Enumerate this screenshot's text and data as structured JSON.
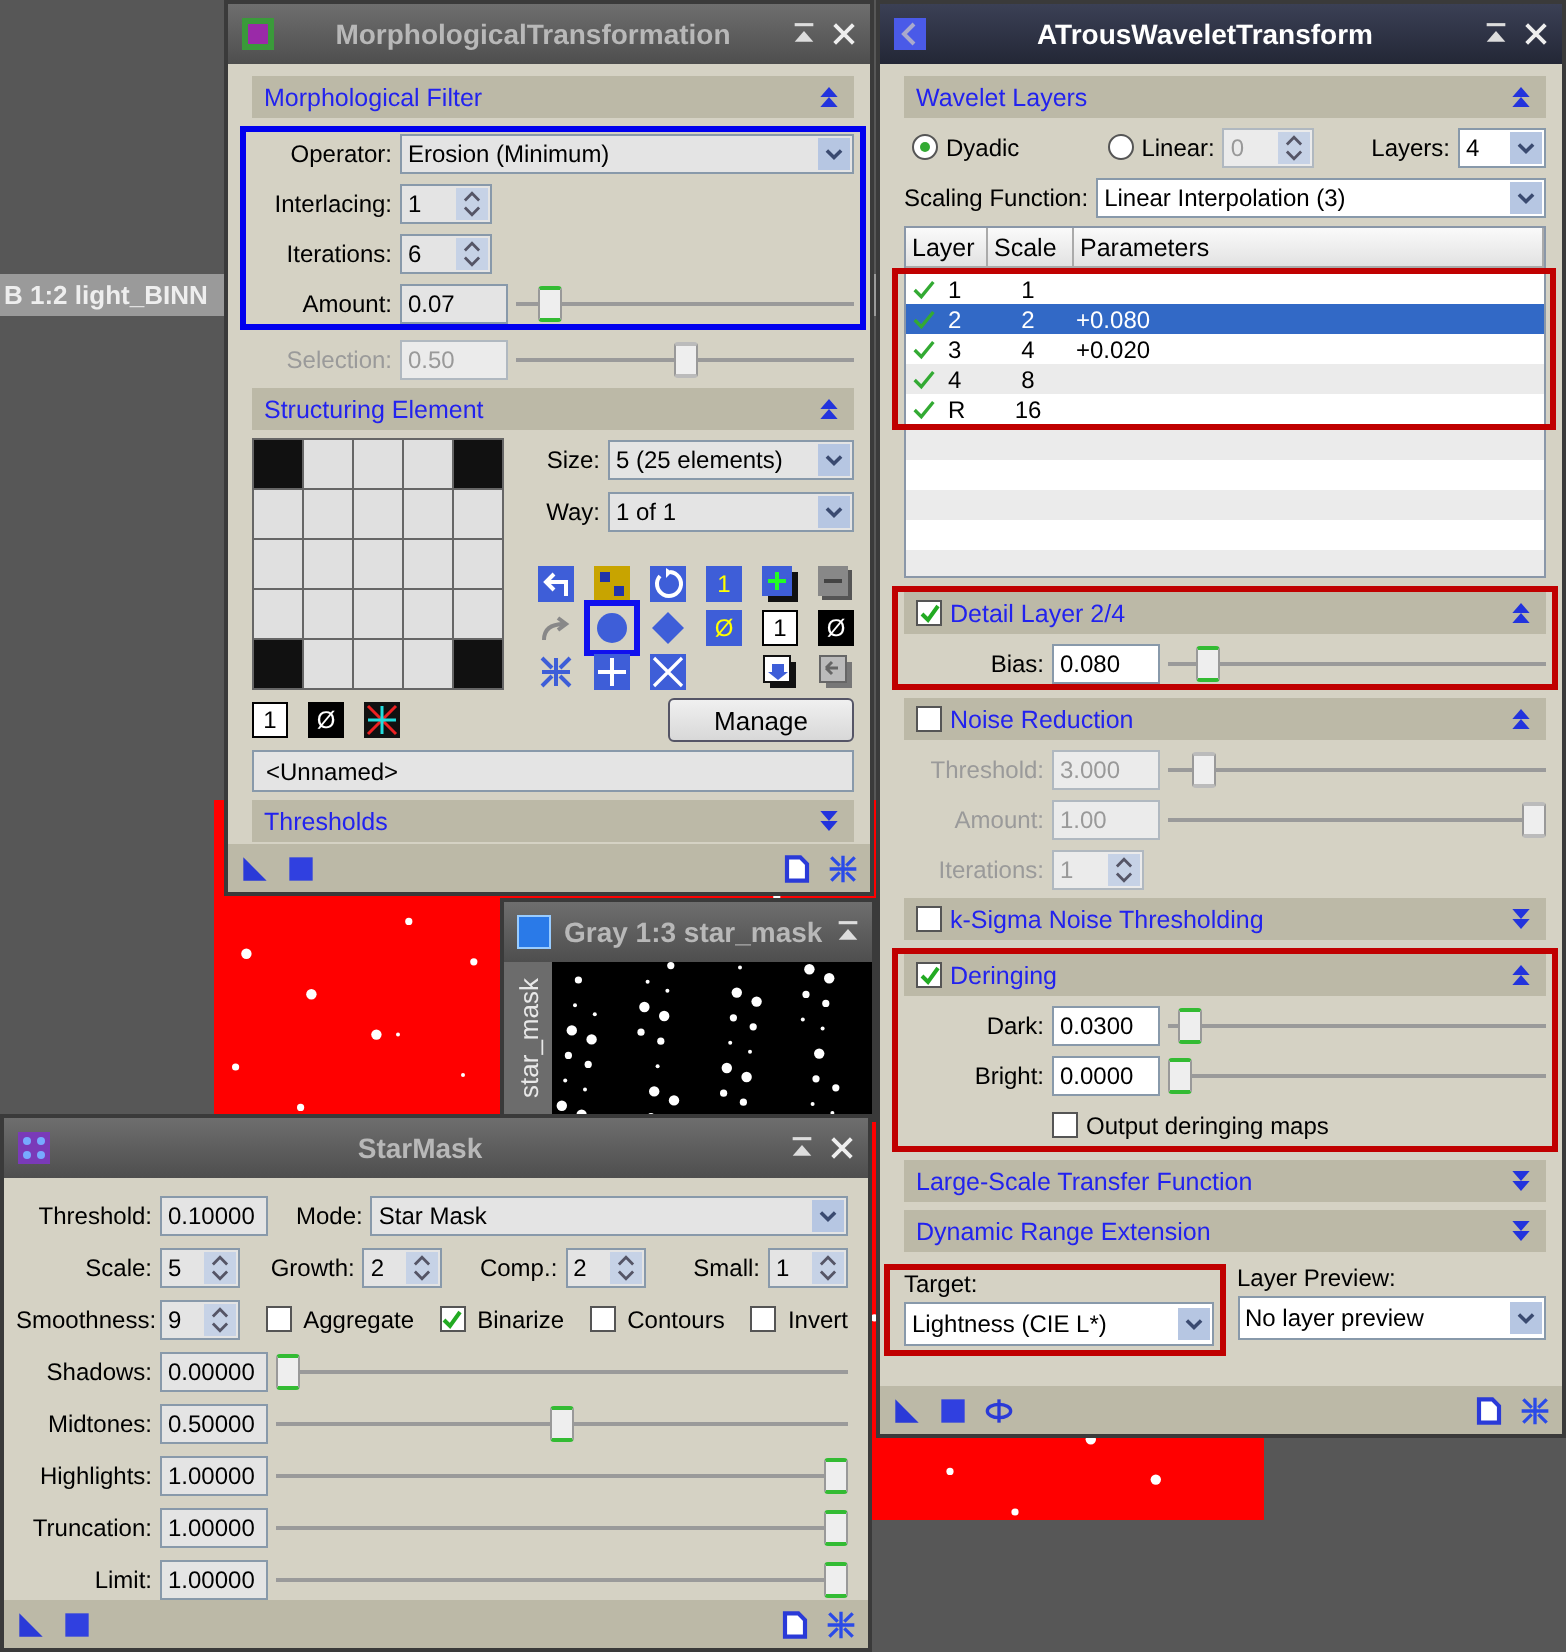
{
  "desktop": {
    "background_window_title": "B 1:2 light_BINN"
  },
  "image_window": {
    "title": "Gray 1:3 star_mask",
    "tab": "star_mask",
    "active": false
  },
  "morphological_transformation": {
    "title": "MorphologicalTransformation",
    "active": false,
    "filter_section": {
      "title": "Morphological Filter",
      "expanded": true,
      "groups": [
        {
          "highlighted": true,
          "fields": [
            {
              "kind": "select",
              "label": "Operator:",
              "value": "Erosion (Minimum)",
              "disabled": false
            },
            {
              "kind": "spin",
              "label": "Interlacing:",
              "value": "1",
              "disabled": false
            },
            {
              "kind": "spin",
              "label": "Iterations:",
              "value": "6",
              "disabled": false
            },
            {
              "kind": "slider",
              "label": "Amount:",
              "value": "0.07",
              "level": 0.07,
              "disabled": false
            }
          ]
        },
        {
          "fields": [
            {
              "kind": "slider",
              "label": "Selection:",
              "value": "0.50",
              "level": 0.5,
              "disabled": true
            }
          ]
        }
      ]
    },
    "structuring_section": {
      "title": "Structuring Element",
      "expanded": true,
      "cells": [
        {
          "active": false
        },
        {
          "active": true
        },
        {
          "active": true
        },
        {
          "active": true
        },
        {
          "active": false
        },
        {
          "active": true
        },
        {
          "active": true
        },
        {
          "active": true
        },
        {
          "active": true
        },
        {
          "active": true
        },
        {
          "active": true
        },
        {
          "active": true
        },
        {
          "active": true
        },
        {
          "active": true
        },
        {
          "active": true
        },
        {
          "active": true
        },
        {
          "active": true
        },
        {
          "active": true
        },
        {
          "active": true
        },
        {
          "active": true
        },
        {
          "active": false
        },
        {
          "active": true
        },
        {
          "active": true
        },
        {
          "active": true
        },
        {
          "active": false
        }
      ],
      "size": {
        "label": "Size:",
        "value": "5  (25 elements)"
      },
      "way": {
        "label": "Way:",
        "value": "1 of 1"
      },
      "tool_buttons": [
        {
          "kind": "undo",
          "selected": false
        },
        {
          "kind": "checker",
          "selected": false
        },
        {
          "kind": "rotate",
          "selected": false
        },
        {
          "kind": "glyph-blue",
          "glyph": "1",
          "selected": false
        },
        {
          "kind": "add",
          "selected": false
        },
        {
          "kind": "remove",
          "selected": false
        },
        {
          "kind": "redo",
          "selected": false
        },
        {
          "kind": "circle",
          "selected": true
        },
        {
          "kind": "diamond",
          "selected": false
        },
        {
          "kind": "glyph-blue",
          "glyph": "Ø",
          "selected": false
        },
        {
          "kind": "glyph-white",
          "glyph": "1",
          "selected": false
        },
        {
          "kind": "glyph-black",
          "glyph": "Ø",
          "selected": false
        },
        {
          "kind": "shrink",
          "selected": false
        },
        {
          "kind": "plus",
          "selected": false
        },
        {
          "kind": "cross",
          "selected": false
        },
        {
          "kind": "import",
          "selected": false
        },
        {
          "kind": "export",
          "selected": false
        }
      ],
      "element_buttons": [
        {
          "kind": "glyph-white",
          "glyph": "1"
        },
        {
          "kind": "glyph-black",
          "glyph": "Ø"
        },
        {
          "kind": "asterisk"
        }
      ],
      "manage_button": "Manage",
      "name_field": "<Unnamed>"
    },
    "thresholds_section": {
      "title": "Thresholds",
      "expanded": false
    }
  },
  "atrous_wavelet_transform": {
    "title": "ATrousWaveletTransform",
    "active": true,
    "wavelet_section": {
      "title": "Wavelet Layers",
      "expanded": true,
      "modes": [
        {
          "label": "Dyadic",
          "selected": true
        },
        {
          "label": "Linear:",
          "selected": false
        }
      ],
      "linear_count": {
        "value": "0",
        "disabled": true
      },
      "layers": {
        "label": "Layers:",
        "value": "4"
      },
      "scaling_function": {
        "label": "Scaling Function:",
        "value": "Linear Interpolation (3)"
      },
      "table": {
        "columns": [
          "Layer",
          "Scale",
          "Parameters"
        ],
        "highlighted": true,
        "rows": [
          {
            "enabled": true,
            "layer": "1",
            "scale": "1",
            "selected": false
          },
          {
            "enabled": true,
            "layer": "2",
            "scale": "2",
            "parameters": "+0.080",
            "selected": true
          },
          {
            "enabled": true,
            "layer": "3",
            "scale": "4",
            "parameters": "+0.020",
            "selected": false
          },
          {
            "enabled": true,
            "layer": "4",
            "scale": "8",
            "selected": false
          },
          {
            "enabled": true,
            "layer": "R",
            "scale": "16",
            "selected": false
          }
        ]
      }
    },
    "detail_section": {
      "title": "Detail Layer 2/4",
      "checked": true,
      "expanded": true,
      "highlighted": true,
      "fields": [
        {
          "kind": "slider",
          "label": "Bias:",
          "value": "0.080",
          "level": 0.08,
          "disabled": false
        }
      ]
    },
    "noise_section": {
      "title": "Noise Reduction",
      "checked": false,
      "expanded": true,
      "fields": [
        {
          "kind": "slider",
          "label": "Threshold:",
          "value": "3.000",
          "level": 0.07,
          "disabled": true
        },
        {
          "kind": "slider",
          "label": "Amount:",
          "value": "1.00",
          "level": 1,
          "disabled": true
        },
        {
          "kind": "spin",
          "label": "Iterations:",
          "value": "1",
          "disabled": true
        }
      ]
    },
    "ksigma_section": {
      "title": "k-Sigma Noise Thresholding",
      "checked": false,
      "expanded": false
    },
    "deringing_section": {
      "title": "Deringing",
      "checked": true,
      "expanded": true,
      "highlighted": true,
      "fields": [
        {
          "kind": "slider",
          "label": "Dark:",
          "value": "0.0300",
          "level": 0.03,
          "disabled": false
        },
        {
          "kind": "slider",
          "label": "Bright:",
          "value": "0.0000",
          "level": 0,
          "disabled": false
        }
      ],
      "output_maps": {
        "label": "Output deringing maps",
        "checked": false
      }
    },
    "lstf_section": {
      "title": "Large-Scale Transfer Function",
      "expanded": false
    },
    "dre_section": {
      "title": "Dynamic Range Extension",
      "expanded": false
    },
    "target": {
      "label": "Target:",
      "value": "Lightness (CIE L*)",
      "highlighted": true
    },
    "layer_preview": {
      "label": "Layer Preview:",
      "value": "No layer preview"
    }
  },
  "star_mask": {
    "title": "StarMask",
    "active": false,
    "threshold": {
      "label": "Threshold:",
      "value": "0.10000"
    },
    "mode": {
      "label": "Mode:",
      "value": "Star Mask"
    },
    "spins": [
      {
        "label": "Scale:",
        "value": "5"
      },
      {
        "label": "Growth:",
        "value": "2"
      },
      {
        "label": "Comp.:",
        "value": "2"
      },
      {
        "label": "Small:",
        "value": "1"
      }
    ],
    "smoothness": {
      "label": "Smoothness:",
      "value": "9"
    },
    "options": [
      {
        "label": "Aggregate",
        "checked": false
      },
      {
        "label": "Binarize",
        "checked": true
      },
      {
        "label": "Contours",
        "checked": false
      },
      {
        "label": "Invert",
        "checked": false
      }
    ],
    "sliders": [
      {
        "label": "Shadows:",
        "value": "0.00000",
        "level": 0
      },
      {
        "label": "Midtones:",
        "value": "0.50000",
        "level": 0.5
      },
      {
        "label": "Highlights:",
        "value": "1.00000",
        "level": 1
      },
      {
        "label": "Truncation:",
        "value": "1.00000",
        "level": 1
      },
      {
        "label": "Limit:",
        "value": "1.00000",
        "level": 1
      }
    ]
  }
}
